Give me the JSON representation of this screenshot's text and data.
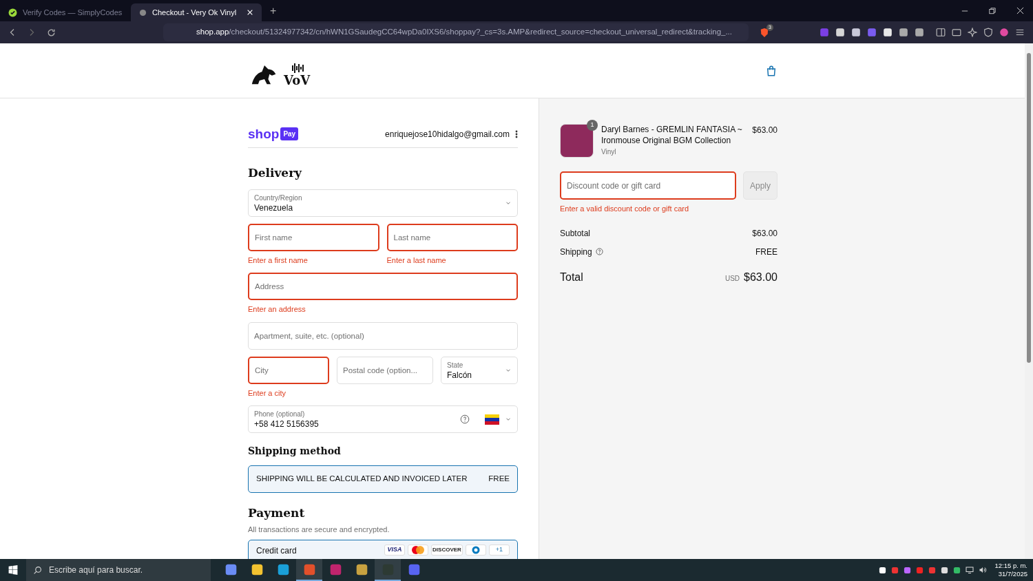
{
  "browser": {
    "tabs": [
      {
        "title": "Verify Codes — SimplyCodes",
        "selected": false
      },
      {
        "title": "Checkout - Very Ok Vinyl",
        "selected": true
      }
    ],
    "new_tab": "+",
    "url_host": "shop.app",
    "url_path": "/checkout/51324977342/cn/hWN1GSaudegCC64wpDa0IXS6/shoppay?_cs=3s.AMP&redirect_source=checkout_universal_redirect&tracking_...",
    "shields_count": "3"
  },
  "header": {
    "logo": "VoV"
  },
  "account": {
    "shop": "shop",
    "pay": "Pay",
    "email": "enriquejose10hidalgo@gmail.com"
  },
  "delivery": {
    "title": "Delivery",
    "rows": [
      [
        {
          "kind": "select",
          "label": "Country/Region",
          "value": "Venezuela",
          "invalid": false
        }
      ],
      [
        {
          "kind": "input",
          "placeholder": "First name",
          "invalid": true,
          "error": "Enter a first name"
        },
        {
          "kind": "input",
          "placeholder": "Last name",
          "invalid": true,
          "error": "Enter a last name"
        }
      ],
      [
        {
          "kind": "input",
          "placeholder": "Address",
          "invalid": true,
          "error": "Enter an address"
        }
      ],
      [
        {
          "kind": "input",
          "placeholder": "Apartment, suite, etc. (optional)",
          "invalid": false
        }
      ],
      [
        {
          "kind": "input",
          "placeholder": "City",
          "invalid": true,
          "error": "Enter a city"
        },
        {
          "kind": "input",
          "placeholder": "Postal code (option...",
          "invalid": false
        },
        {
          "kind": "select",
          "label": "State",
          "value": "Falcón",
          "invalid": false
        }
      ],
      [
        {
          "kind": "phone",
          "label": "Phone (optional)",
          "value": "+58 412 5156395",
          "invalid": false
        }
      ]
    ]
  },
  "shipping_method": {
    "title": "Shipping method",
    "options": [
      {
        "label": "SHIPPING WILL BE CALCULATED AND INVOICED LATER",
        "price": "FREE",
        "selected": true
      }
    ]
  },
  "payment": {
    "title": "Payment",
    "subtitle": "All transactions are secure and encrypted.",
    "methods": [
      {
        "label": "Credit card",
        "selected": true,
        "cards": [
          {
            "kind": "visa",
            "text": "VISA"
          },
          {
            "kind": "mastercard"
          },
          {
            "kind": "discover",
            "text": "DISCOVER"
          },
          {
            "kind": "diners"
          },
          {
            "kind": "more",
            "text": "+1"
          }
        ]
      }
    ]
  },
  "summary": {
    "items": [
      {
        "title": "Daryl Barnes - GREMLIN FANTASIA ~ Ironmouse Original BGM Collection",
        "variant": "Vinyl",
        "price": "$63.00",
        "quantity": "1"
      }
    ],
    "discount": {
      "placeholder": "Discount code or gift card",
      "invalid": true,
      "error": "Enter a valid discount code or gift card",
      "button": "Apply",
      "button_disabled": true
    },
    "lines": [
      {
        "label": "Subtotal",
        "value": "$63.00",
        "help": false
      },
      {
        "label": "Shipping",
        "value": "FREE",
        "help": true
      }
    ],
    "total": {
      "label": "Total",
      "currency": "USD",
      "amount": "$63.00"
    }
  },
  "taskbar": {
    "search_placeholder": "Escribe aquí para buscar.",
    "apps": [
      {
        "kind": "copilot",
        "running": false
      },
      {
        "kind": "files",
        "running": false
      },
      {
        "kind": "edge",
        "running": false
      },
      {
        "kind": "brave",
        "running": true
      },
      {
        "kind": "vortex",
        "running": false
      },
      {
        "kind": "game",
        "running": false
      },
      {
        "kind": "mouse",
        "running": true
      },
      {
        "kind": "chat",
        "running": false
      }
    ],
    "time": "12:15 p. m.",
    "date": "31/7/2025"
  }
}
